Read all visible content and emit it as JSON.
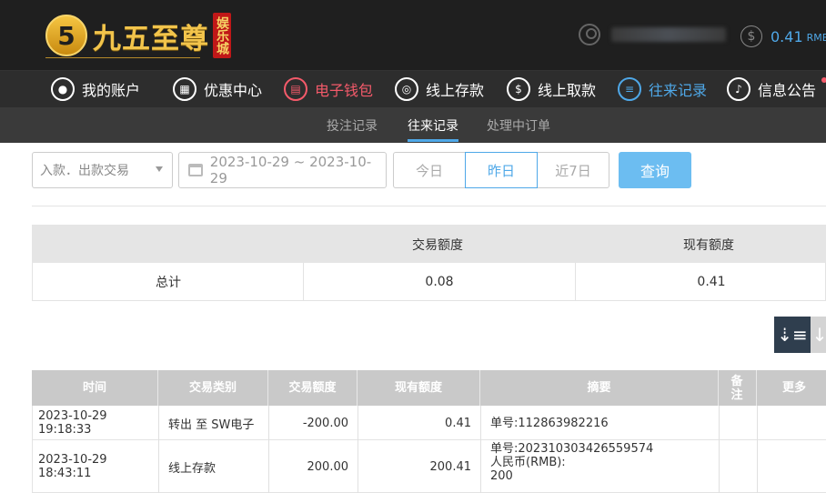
{
  "brand": {
    "logo_mark": "5",
    "name": "九五至尊",
    "badge": "娱乐城"
  },
  "account": {
    "balance": "0.41",
    "currency": "RMB"
  },
  "nav": {
    "items": [
      {
        "label": "我的账户",
        "icon": "user-icon"
      },
      {
        "label": "优惠中心",
        "icon": "gift-icon"
      },
      {
        "label": "电子钱包",
        "icon": "wallet-icon"
      },
      {
        "label": "线上存款",
        "icon": "deposit-icon"
      },
      {
        "label": "线上取款",
        "icon": "withdraw-icon"
      },
      {
        "label": "往来记录",
        "icon": "records-icon"
      },
      {
        "label": "信息公告",
        "icon": "bell-icon"
      }
    ],
    "active": "往来记录"
  },
  "subnav": {
    "items": [
      "投注记录",
      "往来记录",
      "处理中订单"
    ],
    "active": "往来记录"
  },
  "filters": {
    "type_select": "入款．出款交易",
    "date_range": "2023-10-29 ~ 2023-10-29",
    "range_buttons": [
      "今日",
      "昨日",
      "近7日"
    ],
    "selected_range": "昨日",
    "query_label": "查询"
  },
  "summary": {
    "headers": [
      "交易额度",
      "现有额度"
    ],
    "row_label": "总计",
    "transaction_amount": "0.08",
    "current_balance": "0.41"
  },
  "records": {
    "headers": [
      "时间",
      "交易类别",
      "交易额度",
      "现有额度",
      "摘要",
      "备注",
      "更多"
    ],
    "rows": [
      {
        "time": "2023-10-29 19:18:33",
        "type": "转出 至 SW电子",
        "amount": "-200.00",
        "balance": "0.41",
        "summary_lines": [
          "单号:112863982216"
        ]
      },
      {
        "time": "2023-10-29 18:43:11",
        "type": "线上存款",
        "amount": "200.00",
        "balance": "200.41",
        "summary_lines": [
          "单号:202310303426559574",
          "人民币(RMB):",
          "200"
        ]
      }
    ]
  },
  "colors": {
    "accent": "#4fa8e8",
    "wallet": "#f45a6a",
    "gold": "#f2c44b"
  }
}
